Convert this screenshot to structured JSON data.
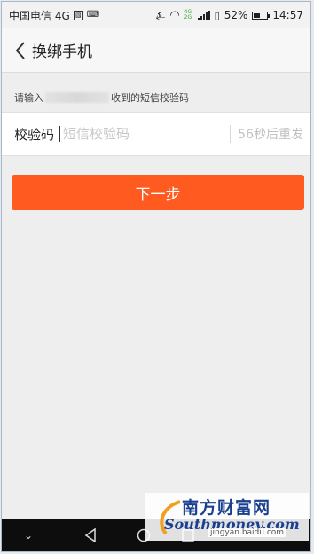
{
  "status_bar": {
    "carrier": "中国电信 4G",
    "battery_percent": "52%",
    "battery_level": 0.52,
    "time": "14:57",
    "network_badge": "4G 2G"
  },
  "header": {
    "title": "换绑手机",
    "back_icon": "chevron-left-icon"
  },
  "hint": {
    "prefix": "请输入",
    "suffix": "收到的短信校验码"
  },
  "form": {
    "label": "校验码",
    "placeholder": "短信校验码",
    "value": "",
    "resend": "56秒后重发"
  },
  "next_button": {
    "label": "下一步"
  },
  "watermark": {
    "cn": "南方财富网",
    "en": "Southmoney.com",
    "source": "jingyan.baidu.com"
  },
  "colors": {
    "accent": "#ff5a1f",
    "background": "#eeeeee",
    "navbar": "#0d0d0d"
  }
}
